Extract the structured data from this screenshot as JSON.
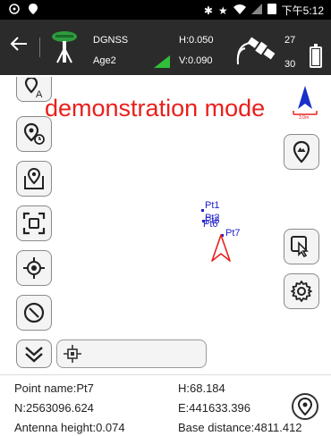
{
  "status_bar": {
    "time": "下午5:12",
    "icons": [
      "cast-icon",
      "location-pin-icon",
      "bluetooth-icon",
      "star-icon",
      "wifi-icon",
      "mobile-signal-icon",
      "sim-icon"
    ]
  },
  "toolbar": {
    "back_icon": "back-arrow-icon",
    "fix_type": "DGNSS",
    "age": "Age2",
    "h_precision": "H:0.050",
    "v_precision": "V:0.090",
    "satellites_used": "27",
    "satellites_total": "30",
    "battery_level": 0.9
  },
  "map": {
    "demo_text": "demonstration mode",
    "scale_label": "3.0m",
    "points": [
      {
        "name": "Pt1"
      },
      {
        "name": "Pt2"
      },
      {
        "name": "Pt3"
      },
      {
        "name": "Pt6"
      },
      {
        "name": "Pt7"
      }
    ],
    "colors": {
      "demo_text": "#e8201c",
      "points": "#2222cc",
      "position_arrow": "#e8201c",
      "north_arrow": "#1a2fc9"
    }
  },
  "left_tools": [
    {
      "name": "auto-label-tool",
      "icon": "pin-a-icon"
    },
    {
      "name": "point-timer-tool",
      "icon": "pin-clock-icon"
    },
    {
      "name": "map-layer-tool",
      "icon": "map-pin-icon"
    },
    {
      "name": "zoom-extent-tool",
      "icon": "fullscreen-icon"
    },
    {
      "name": "locate-tool",
      "icon": "crosshair-icon"
    },
    {
      "name": "compass-tool",
      "icon": "compass-icon"
    },
    {
      "name": "expand-tool",
      "icon": "double-chevron-down-icon"
    }
  ],
  "right_tools": [
    {
      "name": "point-photo-tool",
      "icon": "pin-mountain-icon"
    },
    {
      "name": "select-tool",
      "icon": "pointer-icon"
    },
    {
      "name": "settings-tool",
      "icon": "gear-icon"
    }
  ],
  "info": {
    "point_name": "Point name:Pt7",
    "h": "H:68.184",
    "n": "N:2563096.624",
    "e": "E:441633.396",
    "antenna_height": "Antenna height:0.074",
    "base_distance": "Base distance:4811.412"
  }
}
